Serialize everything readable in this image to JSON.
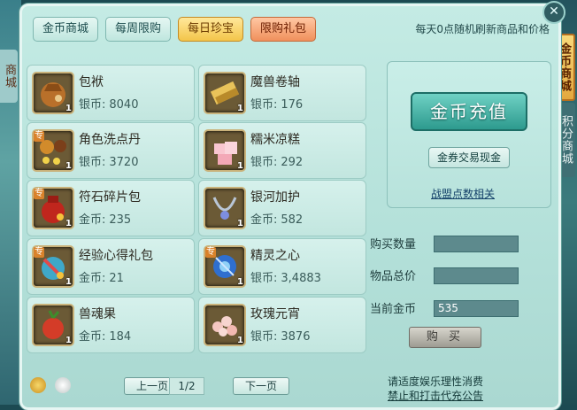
{
  "left_side_tab": "商城",
  "right_side_tabs": {
    "gold_mall": "金币商城",
    "points_mall": "积分商城"
  },
  "tabs": [
    {
      "label": "金币商城"
    },
    {
      "label": "每周限购"
    },
    {
      "label": "每日珍宝"
    },
    {
      "label": "限购礼包"
    }
  ],
  "active_tab": "每日珍宝",
  "refresh_note": "每天0点随机刷新商品和价格",
  "items": [
    {
      "name": "包袱",
      "currency": "银币:",
      "price": "8040",
      "count": "1",
      "icon": "cloth-bundle-icon",
      "special": ""
    },
    {
      "name": "魔兽卷轴",
      "currency": "银币:",
      "price": "176",
      "count": "1",
      "icon": "scroll-icon",
      "special": ""
    },
    {
      "name": "角色洗点丹",
      "currency": "银币:",
      "price": "3720",
      "count": "1",
      "icon": "pill-icon",
      "special": "专"
    },
    {
      "name": "糯米凉糕",
      "currency": "银币:",
      "price": "292",
      "count": "1",
      "icon": "rice-cake-icon",
      "special": ""
    },
    {
      "name": "符石碎片包",
      "currency": "金币:",
      "price": "235",
      "count": "1",
      "icon": "rune-bag-icon",
      "special": "专"
    },
    {
      "name": "银河加护",
      "currency": "金币:",
      "price": "582",
      "count": "1",
      "icon": "necklace-icon",
      "special": ""
    },
    {
      "name": "经验心得礼包",
      "currency": "金币:",
      "price": "21",
      "count": "1",
      "icon": "exp-gift-icon",
      "special": "专"
    },
    {
      "name": "精灵之心",
      "currency": "银币:",
      "price": "3,4883",
      "count": "1",
      "icon": "spirit-heart-icon",
      "special": "专"
    },
    {
      "name": "兽魂果",
      "currency": "金币:",
      "price": "184",
      "count": "1",
      "icon": "beast-fruit-icon",
      "special": ""
    },
    {
      "name": "玫瑰元宵",
      "currency": "银币:",
      "price": "3876",
      "count": "1",
      "icon": "rose-dumpling-icon",
      "special": ""
    }
  ],
  "right_panel": {
    "recharge_label": "金币充值",
    "exchange_label": "金券交易现金",
    "alliance_link": "战盟点数相关"
  },
  "purchase_form": {
    "qty_label": "购买数量",
    "qty_value": "",
    "total_label": "物品总价",
    "total_value": "",
    "gold_label": "当前金币",
    "gold_value": "535",
    "buy_label": "购 买"
  },
  "notice": {
    "line1": "请适度娱乐理性消费",
    "line2": "禁止和打击代充公告"
  },
  "pagination": {
    "prev": "上一页",
    "page": "1/2",
    "next": "下一页"
  },
  "close_label": "✕"
}
